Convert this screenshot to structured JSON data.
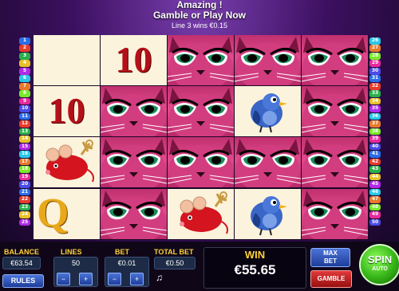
{
  "top_message": {
    "line1": "Amazing !",
    "line2": "Gamble or Play Now",
    "line3": "Line 3 wins €0.15"
  },
  "paylines": {
    "left": [
      "1",
      "2",
      "3",
      "4",
      "5",
      "6",
      "7",
      "8",
      "9",
      "10",
      "11",
      "12",
      "13",
      "14",
      "15",
      "16",
      "17",
      "18",
      "19",
      "20",
      "21",
      "22",
      "23",
      "24",
      "25"
    ],
    "right": [
      "26",
      "27",
      "28",
      "29",
      "30",
      "31",
      "32",
      "33",
      "34",
      "35",
      "36",
      "37",
      "38",
      "39",
      "40",
      "41",
      "42",
      "43",
      "44",
      "45",
      "46",
      "47",
      "48",
      "49",
      "50"
    ],
    "colors": [
      "#2a6ee8",
      "#e83a2a",
      "#2ab04a",
      "#e8c12a",
      "#b02ae8",
      "#2ac8e8",
      "#e87a2a",
      "#7ae82a",
      "#e82a9c",
      "#4a4ae8"
    ]
  },
  "reels": {
    "grid": [
      [
        "plain",
        "10",
        "cat",
        "cat",
        "cat"
      ],
      [
        "10",
        "cat",
        "cat",
        "bird",
        "cat"
      ],
      [
        "mouse",
        "cat",
        "cat",
        "cat",
        "cat"
      ],
      [
        "Q",
        "cat",
        "mouse",
        "bird",
        "cat"
      ]
    ],
    "ten_label": "10",
    "queen_label": "Q"
  },
  "balance": {
    "label": "BALANCE",
    "value": "€63.54"
  },
  "rules": {
    "label": "RULES"
  },
  "lines": {
    "label": "LINES",
    "value": "50",
    "minus": "−",
    "plus": "+"
  },
  "bet": {
    "label": "BET",
    "value": "€0.01",
    "minus": "−",
    "plus": "+"
  },
  "total_bet": {
    "label": "TOTAL BET",
    "value": "€0.50"
  },
  "win": {
    "label": "WIN",
    "value": "€55.65"
  },
  "max_bet": {
    "label": "MAX BET"
  },
  "gamble": {
    "label": "GAMBLE"
  },
  "spin": {
    "label": "SPIN",
    "sub": "AUTO"
  },
  "icons": {
    "sound": "music-note-icon"
  }
}
